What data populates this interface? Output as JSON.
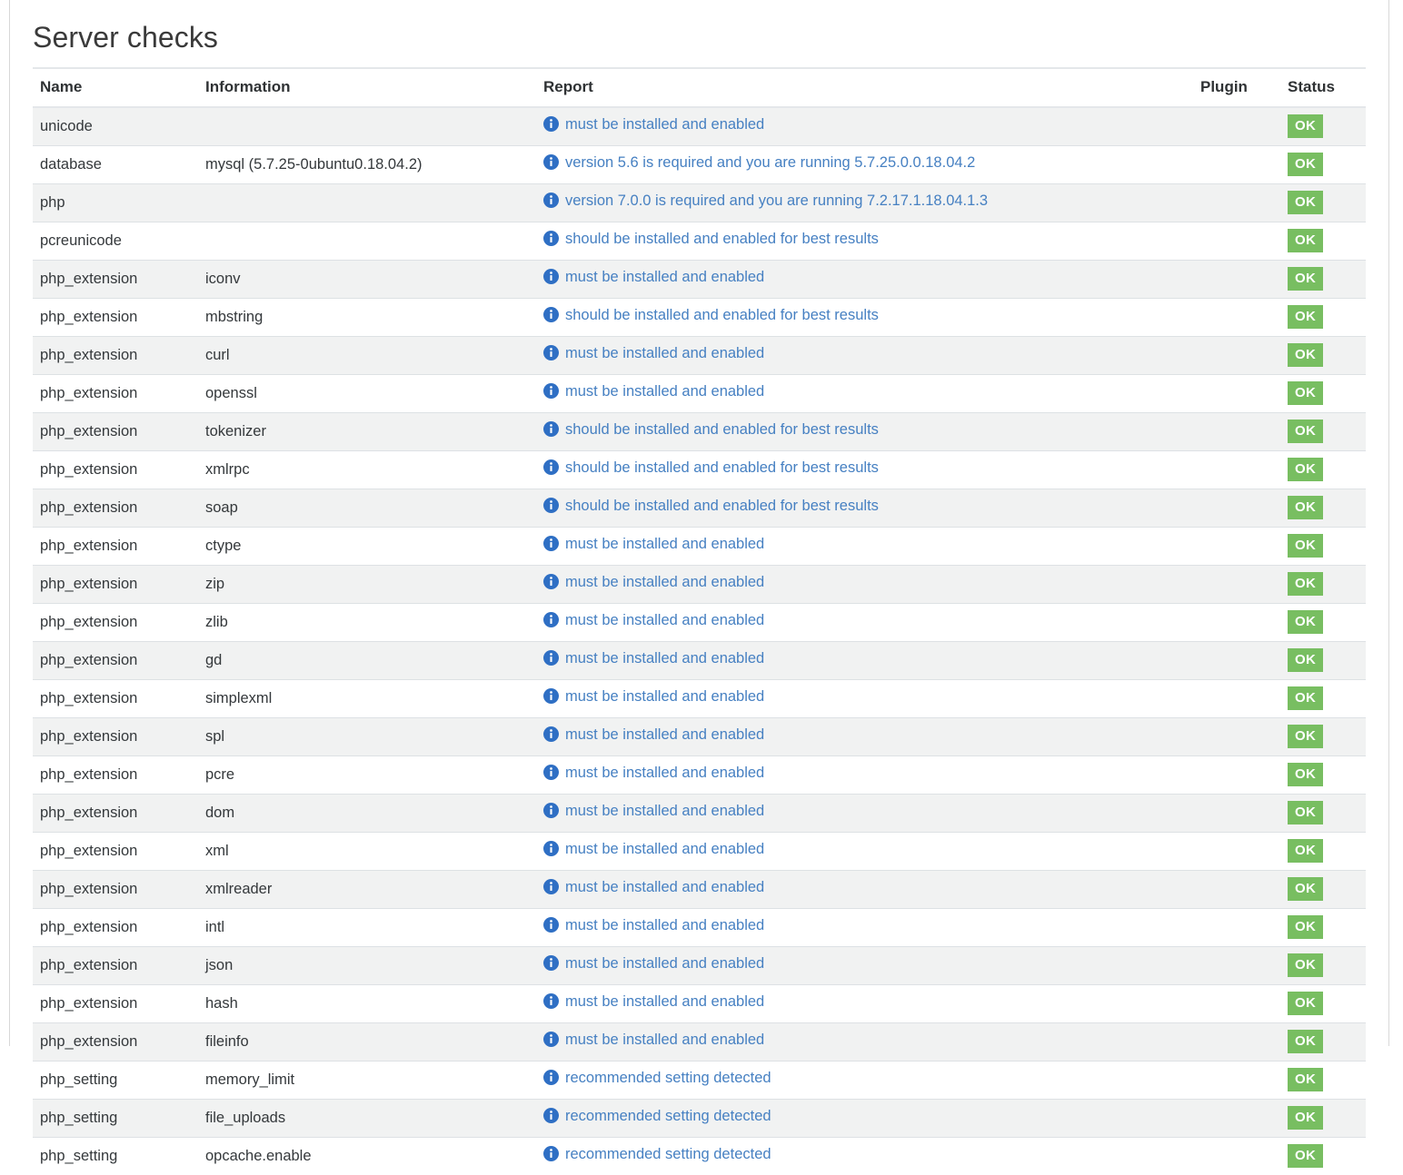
{
  "page": {
    "title": "Server checks",
    "accent_link_color": "#4680c2",
    "status_ok_color": "#78be61",
    "info_icon_color": "#2f6fc4"
  },
  "table": {
    "columns": [
      "Name",
      "Information",
      "Report",
      "Plugin",
      "Status"
    ],
    "info_icon": "info-circle-icon",
    "rows": [
      {
        "name": "unicode",
        "information": "",
        "report": "must be installed and enabled",
        "plugin": "",
        "status": "OK"
      },
      {
        "name": "database",
        "information": "mysql (5.7.25-0ubuntu0.18.04.2)",
        "report": "version 5.6 is required and you are running 5.7.25.0.0.18.04.2",
        "plugin": "",
        "status": "OK"
      },
      {
        "name": "php",
        "information": "",
        "report": "version 7.0.0 is required and you are running 7.2.17.1.18.04.1.3",
        "plugin": "",
        "status": "OK"
      },
      {
        "name": "pcreunicode",
        "information": "",
        "report": "should be installed and enabled for best results",
        "plugin": "",
        "status": "OK"
      },
      {
        "name": "php_extension",
        "information": "iconv",
        "report": "must be installed and enabled",
        "plugin": "",
        "status": "OK"
      },
      {
        "name": "php_extension",
        "information": "mbstring",
        "report": "should be installed and enabled for best results",
        "plugin": "",
        "status": "OK"
      },
      {
        "name": "php_extension",
        "information": "curl",
        "report": "must be installed and enabled",
        "plugin": "",
        "status": "OK"
      },
      {
        "name": "php_extension",
        "information": "openssl",
        "report": "must be installed and enabled",
        "plugin": "",
        "status": "OK"
      },
      {
        "name": "php_extension",
        "information": "tokenizer",
        "report": "should be installed and enabled for best results",
        "plugin": "",
        "status": "OK"
      },
      {
        "name": "php_extension",
        "information": "xmlrpc",
        "report": "should be installed and enabled for best results",
        "plugin": "",
        "status": "OK"
      },
      {
        "name": "php_extension",
        "information": "soap",
        "report": "should be installed and enabled for best results",
        "plugin": "",
        "status": "OK"
      },
      {
        "name": "php_extension",
        "information": "ctype",
        "report": "must be installed and enabled",
        "plugin": "",
        "status": "OK"
      },
      {
        "name": "php_extension",
        "information": "zip",
        "report": "must be installed and enabled",
        "plugin": "",
        "status": "OK"
      },
      {
        "name": "php_extension",
        "information": "zlib",
        "report": "must be installed and enabled",
        "plugin": "",
        "status": "OK"
      },
      {
        "name": "php_extension",
        "information": "gd",
        "report": "must be installed and enabled",
        "plugin": "",
        "status": "OK"
      },
      {
        "name": "php_extension",
        "information": "simplexml",
        "report": "must be installed and enabled",
        "plugin": "",
        "status": "OK"
      },
      {
        "name": "php_extension",
        "information": "spl",
        "report": "must be installed and enabled",
        "plugin": "",
        "status": "OK"
      },
      {
        "name": "php_extension",
        "information": "pcre",
        "report": "must be installed and enabled",
        "plugin": "",
        "status": "OK"
      },
      {
        "name": "php_extension",
        "information": "dom",
        "report": "must be installed and enabled",
        "plugin": "",
        "status": "OK"
      },
      {
        "name": "php_extension",
        "information": "xml",
        "report": "must be installed and enabled",
        "plugin": "",
        "status": "OK"
      },
      {
        "name": "php_extension",
        "information": "xmlreader",
        "report": "must be installed and enabled",
        "plugin": "",
        "status": "OK"
      },
      {
        "name": "php_extension",
        "information": "intl",
        "report": "must be installed and enabled",
        "plugin": "",
        "status": "OK"
      },
      {
        "name": "php_extension",
        "information": "json",
        "report": "must be installed and enabled",
        "plugin": "",
        "status": "OK"
      },
      {
        "name": "php_extension",
        "information": "hash",
        "report": "must be installed and enabled",
        "plugin": "",
        "status": "OK"
      },
      {
        "name": "php_extension",
        "information": "fileinfo",
        "report": "must be installed and enabled",
        "plugin": "",
        "status": "OK"
      },
      {
        "name": "php_setting",
        "information": "memory_limit",
        "report": "recommended setting detected",
        "plugin": "",
        "status": "OK"
      },
      {
        "name": "php_setting",
        "information": "file_uploads",
        "report": "recommended setting detected",
        "plugin": "",
        "status": "OK"
      },
      {
        "name": "php_setting",
        "information": "opcache.enable",
        "report": "recommended setting detected",
        "plugin": "",
        "status": "OK"
      }
    ]
  }
}
